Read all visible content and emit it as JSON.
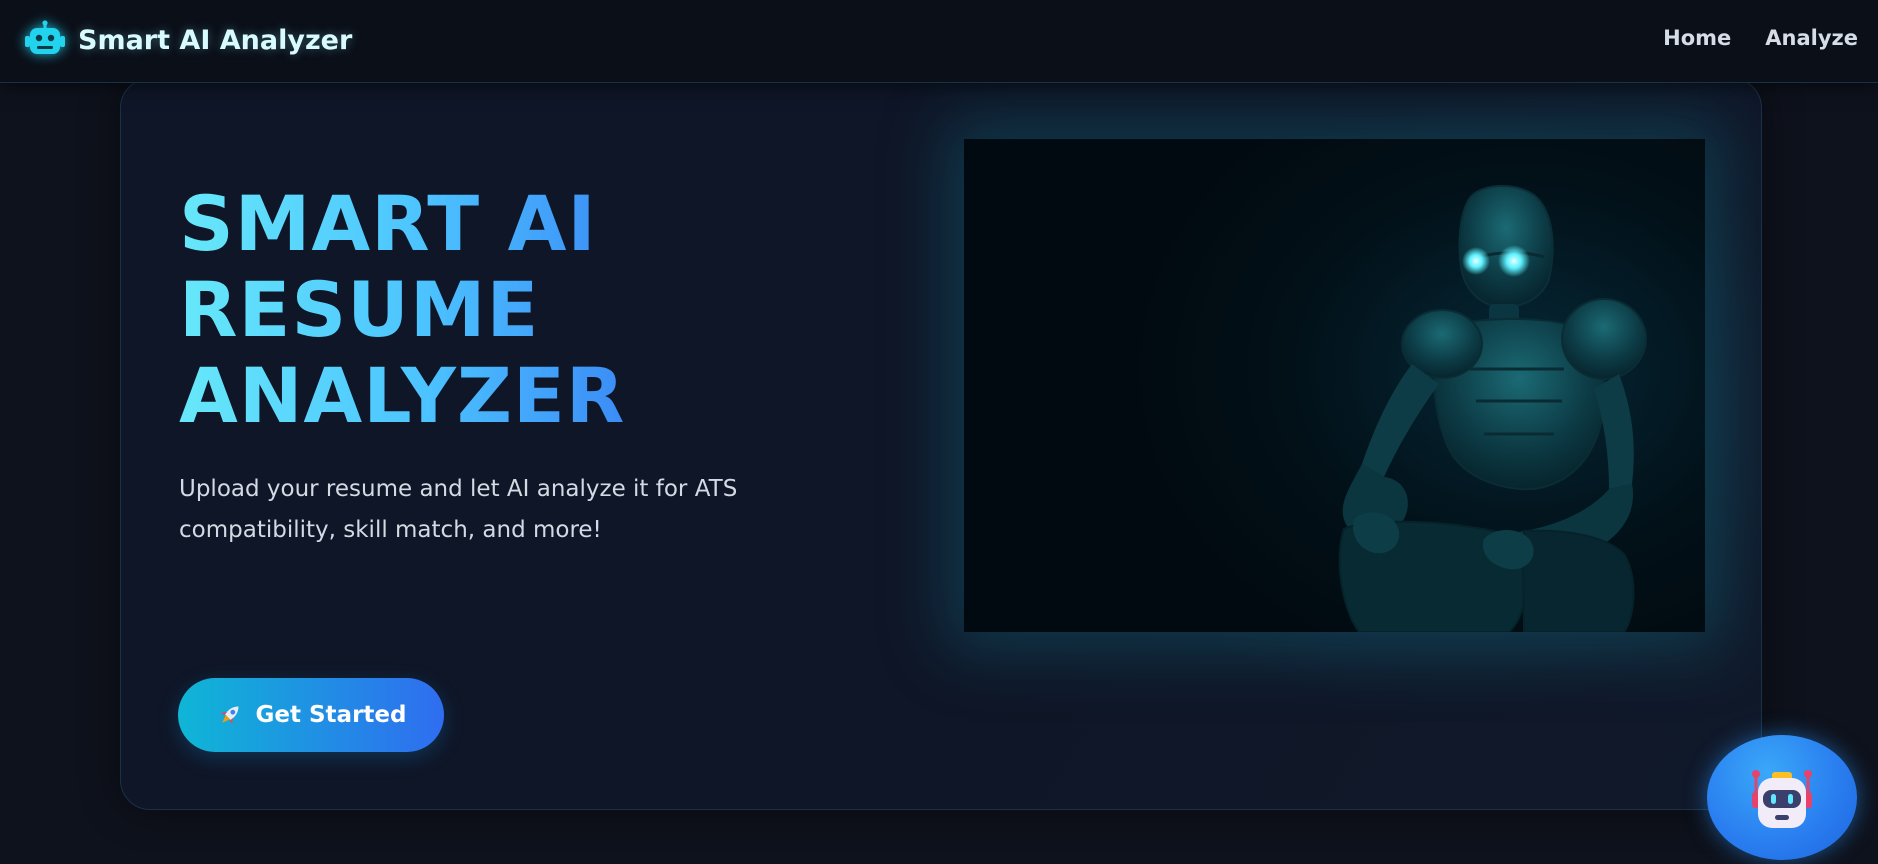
{
  "navbar": {
    "brand_title": "Smart AI Analyzer",
    "brand_icon": "robot-icon",
    "links": [
      {
        "label": "Home"
      },
      {
        "label": "Analyze"
      }
    ]
  },
  "hero": {
    "title_lines": [
      "SMART AI",
      "RESUME",
      "ANALYZER"
    ],
    "subtitle": "Upload your resume and let AI analyze it for ATS compatibility, skill match, and more!",
    "cta": {
      "icon": "rocket-icon",
      "label": "Get Started"
    },
    "image": "robot-illustration"
  },
  "chatbot": {
    "icon": "chatbot-robot-icon"
  },
  "colors": {
    "background": "#0e121c",
    "navbar": "#0b0f18",
    "accent_cyan": "#67e8f9",
    "accent_blue": "#2f6df0",
    "title_gradient_start": "#67e8f9",
    "title_gradient_end": "#3b8cf6"
  }
}
